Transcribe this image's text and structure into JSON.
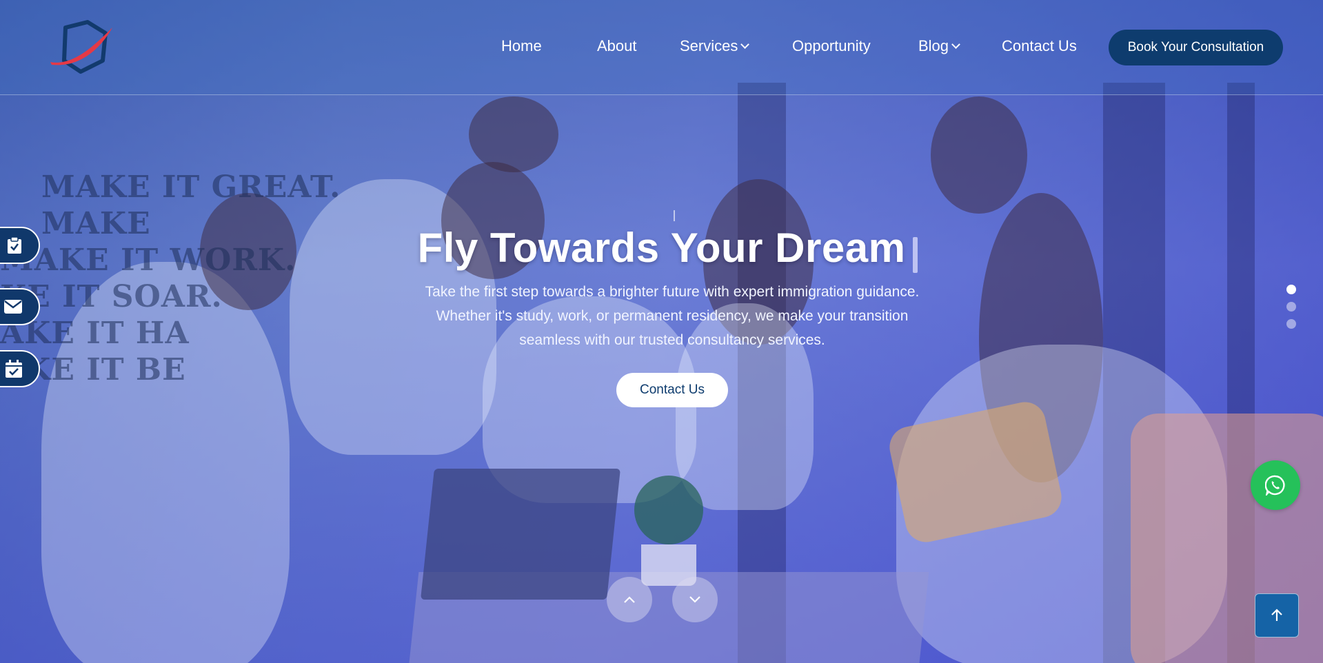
{
  "brand": {
    "logo_icon": "company-logo",
    "accent": "#e63946",
    "primary": "#0e3c6e"
  },
  "nav": {
    "items": [
      {
        "label": "Home"
      },
      {
        "label": "About"
      },
      {
        "label": "Services",
        "has_dropdown": true
      },
      {
        "label": "Opportunity"
      },
      {
        "label": "Blog",
        "has_dropdown": true
      },
      {
        "label": "Contact Us"
      }
    ],
    "cta_label": "Book Your Consultation"
  },
  "hero": {
    "title": "Fly Towards Your Dream",
    "subtitle": "Take the first step towards a brighter future with expert immigration guidance. Whether it's study, work, or permanent residency, we make your transition seamless with our trusted consultancy services.",
    "button_label": "Contact Us",
    "background_wall_text": "MAKE IT GREAT. MAKE IT WORK. MAKE IT SOAR. MAKE IT HAPPEN. MAKE IT BE."
  },
  "side_tabs": [
    {
      "icon": "clipboard-check-icon"
    },
    {
      "icon": "envelope-icon"
    },
    {
      "icon": "calendar-check-icon"
    }
  ],
  "slider": {
    "slides": 3,
    "active_index": 0
  },
  "controls": {
    "prev_icon": "chevron-up-icon",
    "next_icon": "chevron-down-icon",
    "whatsapp_icon": "whatsapp-icon",
    "scroll_top_icon": "arrow-up-icon",
    "whatsapp_color": "#25c15a"
  }
}
